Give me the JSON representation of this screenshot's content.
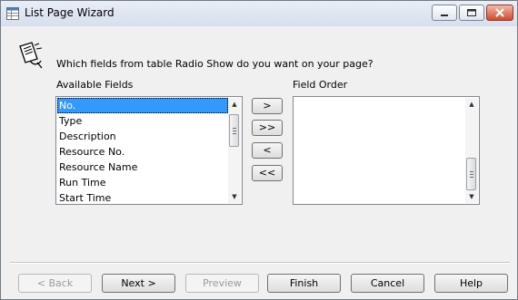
{
  "window": {
    "title": "List Page Wizard"
  },
  "wizard": {
    "question": "Which fields from table Radio Show do you want on your page?",
    "available_label": "Available Fields",
    "order_label": "Field Order",
    "available_fields": [
      "No.",
      "Type",
      "Description",
      "Resource No.",
      "Resource Name",
      "Run Time",
      "Start Time"
    ],
    "selected_field": "No.",
    "field_order": []
  },
  "move_buttons": {
    "add": ">",
    "add_all": ">>",
    "remove": "<",
    "remove_all": "<<"
  },
  "buttons": {
    "back": "< Back",
    "next": "Next >",
    "preview": "Preview",
    "finish": "Finish",
    "cancel": "Cancel",
    "help": "Help"
  },
  "colors": {
    "selection": "#3399ff",
    "close_button": "#d04a2c"
  }
}
